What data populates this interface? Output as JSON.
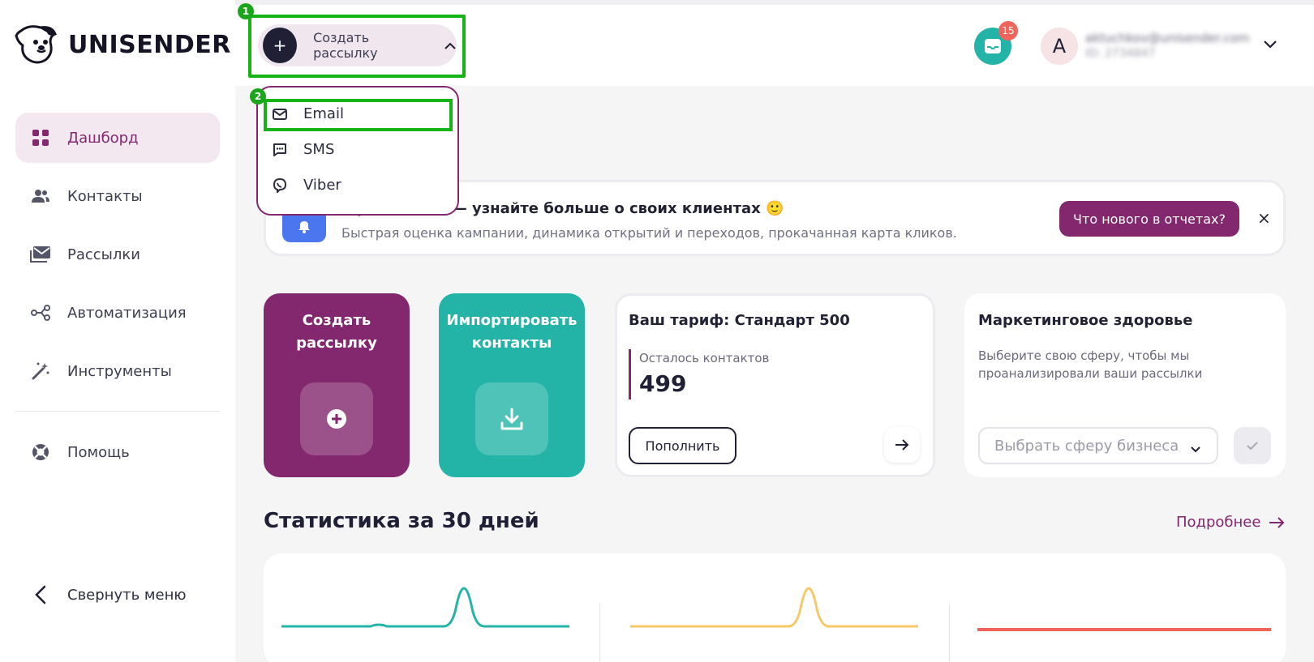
{
  "brand": {
    "name": "UNISENDER"
  },
  "sidebar": {
    "items": [
      {
        "label": "Дашборд",
        "icon": "grid-icon",
        "active": true
      },
      {
        "label": "Контакты",
        "icon": "users-icon",
        "active": false
      },
      {
        "label": "Рассылки",
        "icon": "mail-stack-icon",
        "active": false
      },
      {
        "label": "Автоматизация",
        "icon": "share-nodes-icon",
        "active": false
      },
      {
        "label": "Инструменты",
        "icon": "magic-wand-icon",
        "active": false
      },
      {
        "label": "Помощь",
        "icon": "lifebuoy-icon",
        "active": false
      }
    ],
    "collapse_label": "Свернуть меню"
  },
  "header": {
    "create_label": "Создать рассылку",
    "notifications_count": "15",
    "avatar_letter": "A",
    "account_email": "aktuchkov@unisender.com",
    "account_id": "ID: 2734847"
  },
  "annotations": {
    "step1": "1",
    "step2": "2"
  },
  "dropdown": {
    "items": [
      {
        "label": "Email",
        "icon": "envelope-icon"
      },
      {
        "label": "SMS",
        "icon": "chat-icon"
      },
      {
        "label": "Viber",
        "icon": "viber-icon"
      }
    ]
  },
  "banner": {
    "title": "о рассылках — узнайте больше о своих клиентах 🙂",
    "subtitle": "Быстрая оценка кампании, динамика открытий и переходов, прокачанная карта кликов.",
    "button_label": "Что нового в отчетах?",
    "close_label": "×"
  },
  "cards": {
    "create": {
      "title_line1": "Создать",
      "title_line2": "рассылку"
    },
    "import": {
      "title_line1": "Импортировать",
      "title_line2": "контакты"
    },
    "tariff": {
      "title": "Ваш тариф: Стандарт 500",
      "contacts_label": "Осталось контактов",
      "contacts_value": "499",
      "topup_label": "Пополнить"
    },
    "health": {
      "title": "Маркетинговое здоровье",
      "description": "Выберите свою сферу, чтобы мы проанализировали ваши рассылки",
      "select_placeholder": "Выбрать сферу бизнеса"
    }
  },
  "stats": {
    "title": "Статистика за 30 дней",
    "more_label": "Подробнее"
  },
  "colors": {
    "brand_purple": "#83276e",
    "teal": "#24b4a7",
    "yellow": "#f5c969",
    "red": "#f0645c",
    "highlight_green": "#16b316"
  }
}
